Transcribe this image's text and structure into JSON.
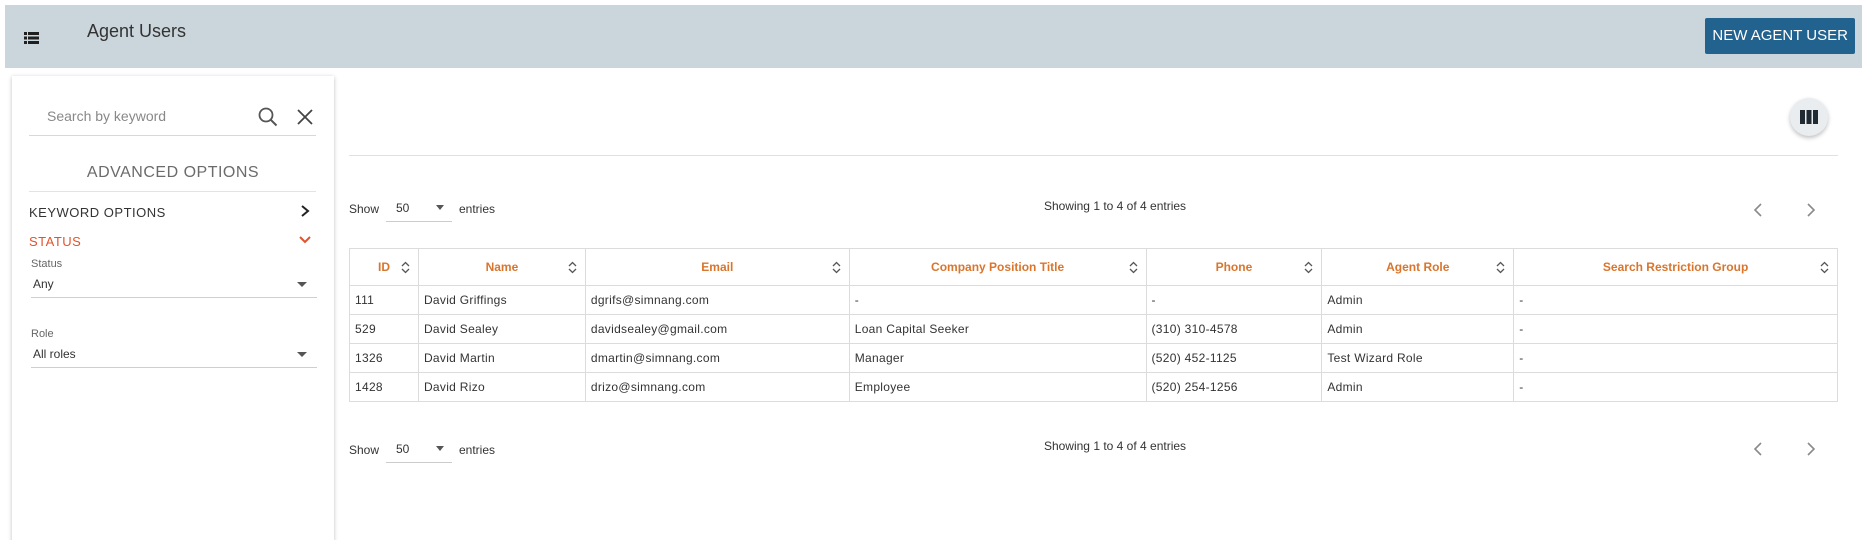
{
  "header": {
    "title": "Agent Users",
    "new_button_label": "NEW AGENT USER",
    "menu_icon": "list-icon",
    "background": "#cbd6dc",
    "button_color": "#21628f"
  },
  "sidebar": {
    "search_placeholder": "Search by keyword",
    "advanced_title": "ADVANCED OPTIONS",
    "keyword_options_label": "KEYWORD OPTIONS",
    "status_section_label": "STATUS",
    "status_field_label": "Status",
    "status_value": "Any",
    "role_field_label": "Role",
    "role_value": "All roles",
    "accent_color": "#e2532d"
  },
  "table_controls": {
    "show_label": "Show",
    "entries_label": "entries",
    "page_length": "50",
    "info_text": "Showing 1 to 4 of 4 entries"
  },
  "table": {
    "columns": [
      "ID",
      "Name",
      "Email",
      "Company Position Title",
      "Phone",
      "Agent Role",
      "Search Restriction Group"
    ],
    "rows": [
      [
        "111",
        "David Griffings",
        "dgrifs@simnang.com",
        "-",
        "-",
        "Admin",
        "-"
      ],
      [
        "529",
        "David Sealey",
        "davidsealey@gmail.com",
        "Loan Capital Seeker",
        "(310) 310-4578",
        "Admin",
        "-"
      ],
      [
        "1326",
        "David Martin",
        "dmartin@simnang.com",
        "Manager",
        "(520) 452-1125",
        "Test Wizard Role",
        "-"
      ],
      [
        "1428",
        "David Rizo",
        "drizo@simnang.com",
        "Employee",
        "(520) 254-1256",
        "Admin",
        "-"
      ]
    ],
    "header_color": "#d9752d"
  }
}
